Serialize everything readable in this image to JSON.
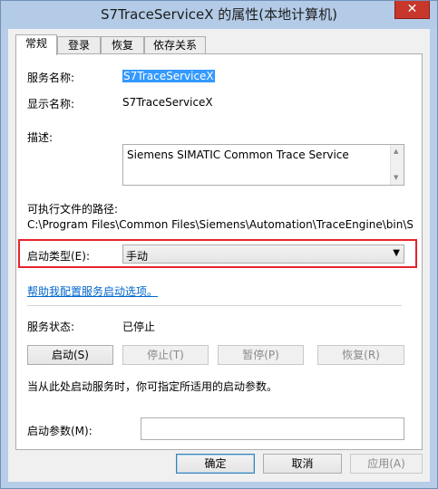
{
  "window": {
    "title": "S7TraceServiceX 的属性(本地计算机)",
    "close": "✕"
  },
  "tabs": [
    "常规",
    "登录",
    "恢复",
    "依存关系"
  ],
  "general": {
    "service_name_label": "服务名称:",
    "service_name": "S7TraceServiceX",
    "display_name_label": "显示名称:",
    "display_name": "S7TraceServiceX",
    "description_label": "描述:",
    "description": "Siemens SIMATIC Common Trace Service",
    "exe_path_label": "可执行文件的路径:",
    "exe_path": "C:\\Program Files\\Common Files\\Siemens\\Automation\\TraceEngine\\bin\\S",
    "startup_type_label": "启动类型(E):",
    "startup_type": "手动",
    "help_link": "帮助我配置服务启动选项。",
    "status_label": "服务状态:",
    "status_value": "已停止",
    "buttons": {
      "start": "启动(S)",
      "stop": "停止(T)",
      "pause": "暂停(P)",
      "resume": "恢复(R)"
    },
    "hint": "当从此处启动服务时，你可指定所适用的启动参数。",
    "start_params_label": "启动参数(M):",
    "start_params_value": ""
  },
  "footer": {
    "ok": "确定",
    "cancel": "取消",
    "apply": "应用(A)"
  },
  "colors": {
    "highlight_border": "#e8232b",
    "link": "#0066cc",
    "close_button": "#c7372c"
  }
}
